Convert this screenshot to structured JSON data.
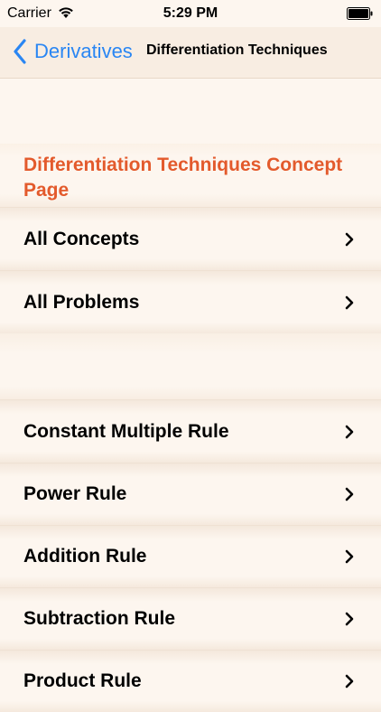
{
  "status_bar": {
    "carrier": "Carrier",
    "time": "5:29 PM"
  },
  "nav": {
    "back_label": "Derivatives",
    "title": "Differentiation Techniques"
  },
  "section": {
    "header": "Differentiation Techniques Concept Page"
  },
  "group1": [
    {
      "label": "All Concepts"
    },
    {
      "label": "All Problems"
    }
  ],
  "group2": [
    {
      "label": "Constant Multiple Rule"
    },
    {
      "label": "Power Rule"
    },
    {
      "label": "Addition Rule"
    },
    {
      "label": "Subtraction Rule"
    },
    {
      "label": "Product Rule"
    }
  ],
  "colors": {
    "accent": "#2a86f3",
    "section_header": "#e35a2c",
    "background": "#fdf6ef"
  }
}
